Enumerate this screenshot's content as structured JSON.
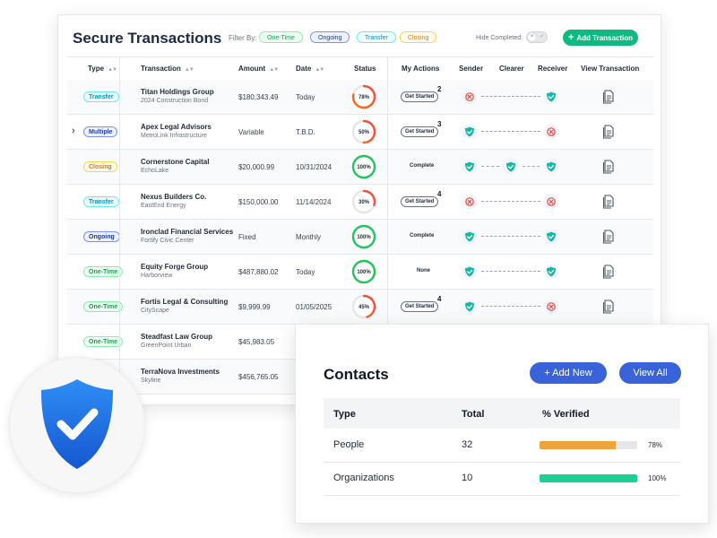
{
  "header": {
    "title": "Secure Transactions",
    "filter_label": "Filter By:",
    "filters": [
      "One-Time",
      "Ongoing",
      "Transfer",
      "Closing"
    ],
    "hide_completed_label": "Hide Completed:",
    "add_button_label": "Add Transaction"
  },
  "table": {
    "columns": [
      "Type",
      "Transaction",
      "Amount",
      "Date",
      "Status",
      "My Actions",
      "Sender",
      "Clearer",
      "Receiver",
      "View Transaction"
    ],
    "rows": [
      {
        "type": "Transfer",
        "type_class": "transfer",
        "name": "Titan Holdings Group",
        "sub": "2024 Construction Bond",
        "amount": "$180,343.49",
        "date": "Today",
        "status_pct": 78,
        "status_label": "78%",
        "action": "Get Started",
        "action_count": "2",
        "sender": "x",
        "clearer": "",
        "receiver": "ok",
        "expanded": false
      },
      {
        "type": "Multiple",
        "type_class": "multiple",
        "name": "Apex Legal Advisors",
        "sub": "MetroLink Infrastructure",
        "amount": "Variable",
        "date": "T.B.D.",
        "status_pct": 50,
        "status_label": "50%",
        "action": "Get Started",
        "action_count": "3",
        "sender": "ok",
        "clearer": "",
        "receiver": "x",
        "expanded": true
      },
      {
        "type": "Closing",
        "type_class": "closing",
        "name": "Cornerstone Capital",
        "sub": "EchoLake",
        "amount": "$20,000.99",
        "date": "10/31/2024",
        "status_pct": 100,
        "status_label": "100%",
        "action": "Complete",
        "action_count": "",
        "sender": "ok",
        "clearer": "ok",
        "receiver": "ok",
        "expanded": false
      },
      {
        "type": "Transfer",
        "type_class": "transfer",
        "name": "Nexus Builders Co.",
        "sub": "EastEnd Energy",
        "amount": "$150,000.00",
        "date": "11/14/2024",
        "status_pct": 30,
        "status_label": "30%",
        "action": "Get Started",
        "action_count": "4",
        "sender": "x",
        "clearer": "",
        "receiver": "x",
        "expanded": false
      },
      {
        "type": "Ongoing",
        "type_class": "ongoing",
        "name": "Ironclad Financial Services",
        "sub": "Fortify Civic Center",
        "amount": "Fixed",
        "date": "Monthly",
        "status_pct": 100,
        "status_label": "100%",
        "action": "Complete",
        "action_count": "",
        "sender": "ok",
        "clearer": "",
        "receiver": "ok",
        "expanded": false
      },
      {
        "type": "One-Time",
        "type_class": "onetime",
        "name": "Equity Forge Group",
        "sub": "Harborview",
        "amount": "$487,880.02",
        "date": "Today",
        "status_pct": 100,
        "status_label": "100%",
        "action": "None",
        "action_count": "",
        "sender": "ok",
        "clearer": "",
        "receiver": "ok",
        "expanded": false
      },
      {
        "type": "One-Time",
        "type_class": "onetime",
        "name": "Fortis Legal & Consulting",
        "sub": "CityScape",
        "amount": "$9,999.99",
        "date": "01/05/2025",
        "status_pct": 45,
        "status_label": "45%",
        "action": "Get Started",
        "action_count": "4",
        "sender": "ok",
        "clearer": "",
        "receiver": "x",
        "expanded": false
      },
      {
        "type": "One-Time",
        "type_class": "onetime",
        "name": "Steadfast Law Group",
        "sub": "GreenPoint Urban",
        "amount": "$45,983.05",
        "date": "",
        "status_pct": null,
        "status_label": "",
        "action": "",
        "action_count": "",
        "sender": "",
        "clearer": "",
        "receiver": "",
        "expanded": false
      },
      {
        "type": "",
        "type_class": "",
        "name": "TerraNova Investments",
        "sub": "Skyline",
        "amount": "$456,765.05",
        "date": "",
        "status_pct": null,
        "status_label": "",
        "action": "",
        "action_count": "",
        "sender": "",
        "clearer": "",
        "receiver": "",
        "expanded": false
      }
    ]
  },
  "contacts": {
    "title": "Contacts",
    "add_label": "+ Add New",
    "view_label": "View All",
    "columns": [
      "Type",
      "Total",
      "% Verified"
    ],
    "rows": [
      {
        "type": "People",
        "total": "32",
        "pct": 78,
        "pct_label": "78%",
        "color": "#f0a23b"
      },
      {
        "type": "Organizations",
        "total": "10",
        "pct": 100,
        "pct_label": "100%",
        "color": "#1fcf96"
      }
    ]
  },
  "colors": {
    "accent_green": "#10b981",
    "contacts_button": "#3b63d9",
    "shield_blue": "#1f6fe0",
    "status_orange": "#f97316",
    "status_green": "#22c55e",
    "error_red": "#ef4444"
  },
  "icons": {
    "shield": "shield-check-icon",
    "view": "document-icon",
    "ok": "shield-check-icon",
    "x": "x-circle-icon"
  }
}
